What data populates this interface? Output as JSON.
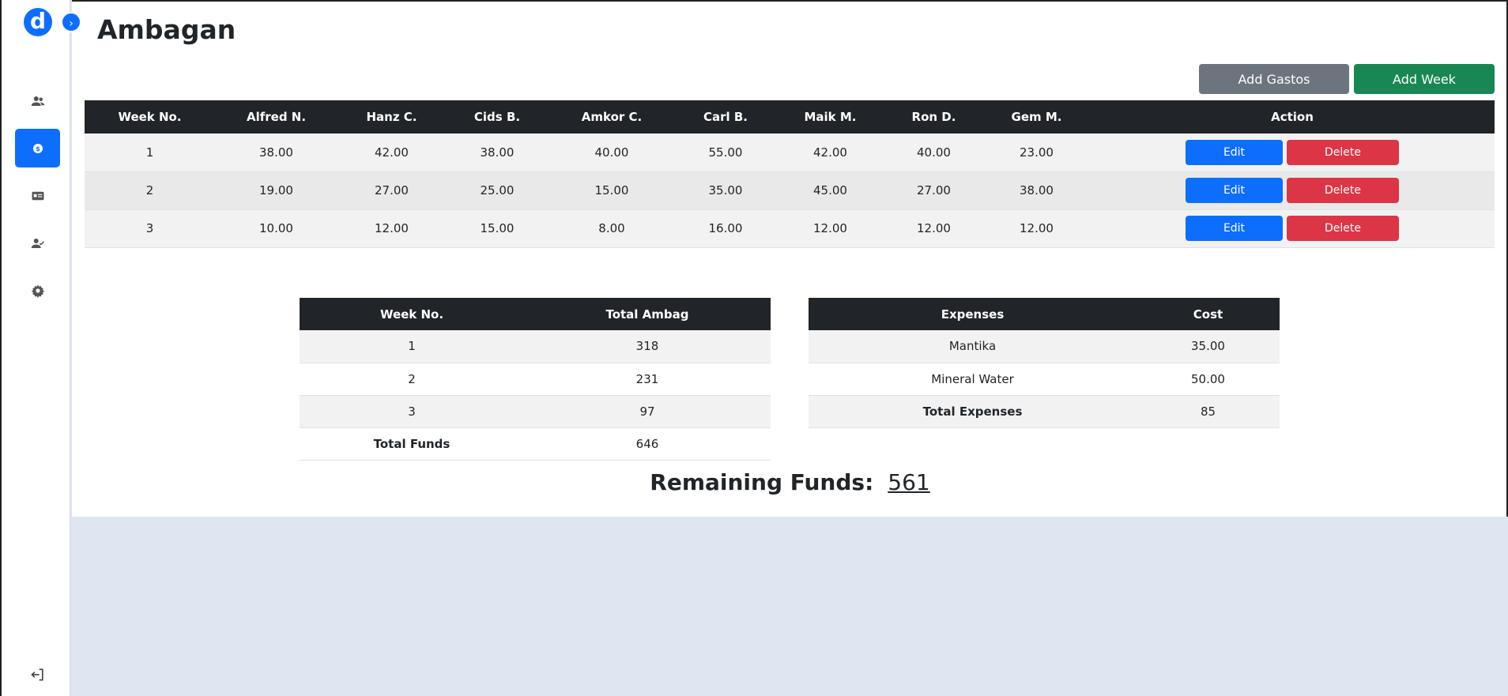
{
  "app": {
    "logo_letter": "d",
    "toggle_glyph": "›"
  },
  "sidebar": {
    "items": [
      {
        "name": "users",
        "icon": "users-icon"
      },
      {
        "name": "funds",
        "icon": "dollar-icon",
        "active": true
      },
      {
        "name": "id-card",
        "icon": "id-card-icon"
      },
      {
        "name": "user-check",
        "icon": "user-check-icon"
      },
      {
        "name": "settings",
        "icon": "gear-icon"
      }
    ],
    "logout_icon": "logout-icon"
  },
  "header": {
    "title": "Ambagan"
  },
  "toolbar": {
    "add_gastos_label": "Add Gastos",
    "add_week_label": "Add Week"
  },
  "weeks_table": {
    "headers": [
      "Week No.",
      "Alfred N.",
      "Hanz C.",
      "Cids B.",
      "Amkor C.",
      "Carl B.",
      "Maik M.",
      "Ron D.",
      "Gem M.",
      "Action"
    ],
    "rows": [
      [
        "1",
        "38.00",
        "42.00",
        "38.00",
        "40.00",
        "55.00",
        "42.00",
        "40.00",
        "23.00"
      ],
      [
        "2",
        "19.00",
        "27.00",
        "25.00",
        "15.00",
        "35.00",
        "45.00",
        "27.00",
        "38.00"
      ],
      [
        "3",
        "10.00",
        "12.00",
        "15.00",
        "8.00",
        "16.00",
        "12.00",
        "12.00",
        "12.00"
      ]
    ],
    "edit_label": "Edit",
    "delete_label": "Delete"
  },
  "summary_table": {
    "headers": [
      "Week No.",
      "Total Ambag"
    ],
    "rows": [
      [
        "1",
        "318"
      ],
      [
        "2",
        "231"
      ],
      [
        "3",
        "97"
      ]
    ],
    "total_label": "Total Funds",
    "total_value": "646"
  },
  "expenses_table": {
    "headers": [
      "Expenses",
      "Cost"
    ],
    "rows": [
      [
        "Mantika",
        "35.00"
      ],
      [
        "Mineral Water",
        "50.00"
      ]
    ],
    "total_label": "Total Expenses",
    "total_value": "85"
  },
  "remaining": {
    "label": "Remaining Funds:",
    "value": "561"
  },
  "colors": {
    "primary": "#0d6efd",
    "success": "#198754",
    "secondary": "#6c757d",
    "danger": "#dc3545",
    "dark": "#212529",
    "background": "#dfe6f1"
  }
}
